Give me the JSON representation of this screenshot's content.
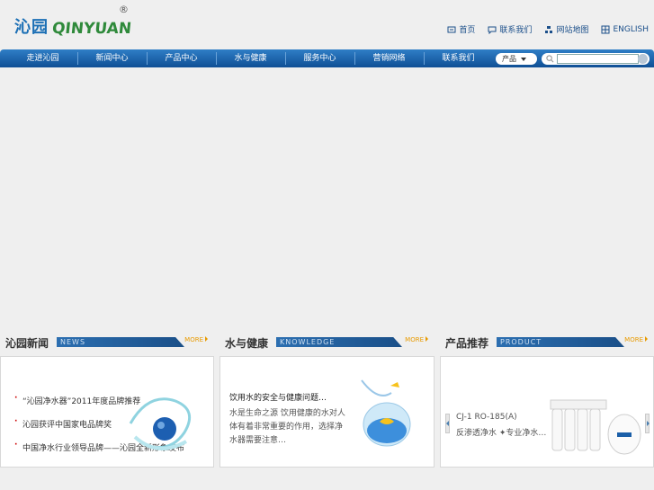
{
  "header": {
    "logo_cn": "沁园",
    "logo_en": "QINYUAN",
    "logo_reg": "®",
    "links": [
      {
        "label": "首页",
        "icon": "home-icon"
      },
      {
        "label": "联系我们",
        "icon": "chat-icon"
      },
      {
        "label": "网站地图",
        "icon": "sitemap-icon"
      },
      {
        "label": "ENGLISH",
        "icon": "globe-icon"
      }
    ]
  },
  "nav": {
    "items": [
      "走进沁园",
      "新闻中心",
      "产品中心",
      "水与健康",
      "服务中心",
      "营销网络",
      "联系我们"
    ],
    "search_select": "产品",
    "search_value": ""
  },
  "panels": {
    "news": {
      "title_cn": "沁园新闻",
      "title_en": "NEWS",
      "more": "MORE",
      "items": [
        "“沁园净水器”2011年度品牌推荐",
        "沁园获评中国家电品牌奖",
        "中国净水行业领导品牌——沁园全新形象发布"
      ]
    },
    "knowledge": {
      "title_cn": "水与健康",
      "title_en": "KNOWLEDGE",
      "more": "MORE",
      "headline": "饮用水的安全与健康问题…",
      "desc": "水是生命之源 饮用健康的水对人体有着非常重要的作用，选择净水器需要注意…"
    },
    "product": {
      "title_cn": "产品推荐",
      "title_en": "PRODUCT",
      "more": "MORE",
      "model": "CJ-1 RO-185(A)",
      "desc": "反渗透净水 ✦专业净水…"
    }
  },
  "colors": {
    "brand_blue": "#1b6fb5",
    "brand_green": "#2f8a3b",
    "nav_blue": "#0f4f95",
    "more_orange": "#e89a00"
  }
}
